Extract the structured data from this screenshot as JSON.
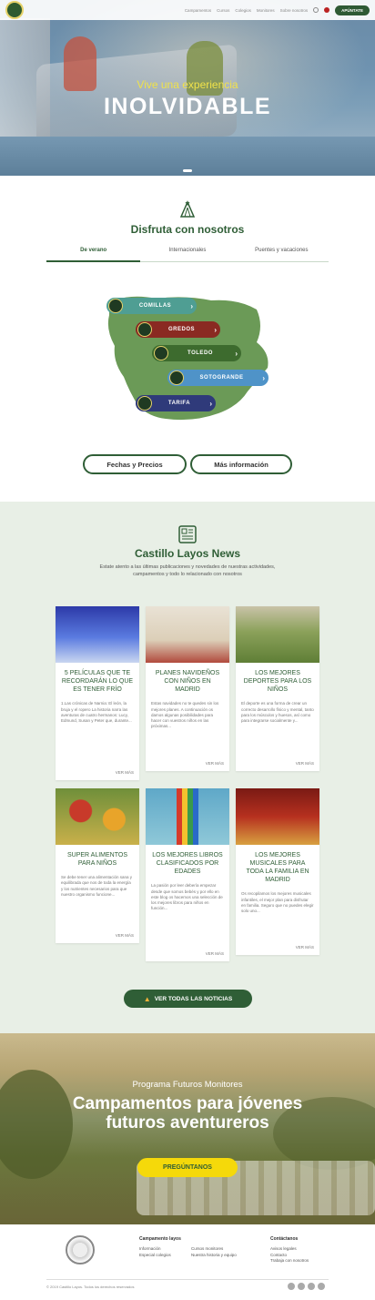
{
  "header": {
    "nav": [
      "Campamentos",
      "Cursos",
      "Colegios",
      "Monitores",
      "Sobre nosotros"
    ],
    "cta": "APÚNTATE"
  },
  "hero": {
    "subtitle": "Vive una experiencia",
    "title": "INOLVIDABLE"
  },
  "disfruta": {
    "title": "Disfruta con nosotros",
    "tabs": [
      "De verano",
      "Internacionales",
      "Puentes y vacaciones"
    ],
    "active_tab": "De verano",
    "locations": [
      "COMILLAS",
      "GREDOS",
      "TOLEDO",
      "SOTOGRANDE",
      "TARIFA"
    ],
    "location_colors": [
      "#4f9e93",
      "#8a2a22",
      "#3d6b2e",
      "#4f93c8",
      "#2f3a7a"
    ],
    "buttons": [
      "Fechas y Precios",
      "Más información"
    ]
  },
  "news": {
    "title": "Castillo Layos News",
    "description": "Estate atento a las últimas publicaciones y novedades de nuestras actividades, campamentos y todo lo relacionado con nosotros",
    "read_more": "VER MÁS",
    "cards": [
      {
        "title": "5 PELÍCULAS QUE TE RECORDARÁN LO QUE ES TENER FRÍO",
        "text": "1.Las crónicas de Narnia: El león, la bruja y el ropero La historia narra las aventuras de cuatro hermanos: Lucy, Edmund, Susan y Peter que, durante..."
      },
      {
        "title": "PLANES NAVIDEÑOS CON NIÑOS EN MADRID",
        "text": "Estas navidades no te quedes sin los mejores planes. A continuación os damos algunas posibilidades para hacer con vuestros niños en las próximas..."
      },
      {
        "title": "LOS MEJORES DEPORTES PARA LOS NIÑOS",
        "text": "El deporte es una forma de crear un correcto desarrollo físico y mental, tanto para los músculos y huesos, así como para integrarse socialmente y..."
      },
      {
        "title": "SUPER ALIMENTOS PARA NIÑOS",
        "text": "Se debe tener una alimentación sana y equilibrada que nos de toda la energía y los nutrientes necesarios para que nuestro organismo funcione..."
      },
      {
        "title": "LOS MEJORES LIBROS CLASIFICADOS POR EDADES",
        "text": "La pasión por leer debería empezar desde que somos bebés y por ello en este blog os hacemos una selección de los mejores libros para niños en función..."
      },
      {
        "title": "LOS MEJORES MUSICALES PARA TODA LA FAMILIA EN MADRID",
        "text": "Os recopilamos los mejores musicales infantiles, el mejor plan para disfrutar en familia. Seguro que no puedes elegir solo uno..."
      }
    ],
    "all_button": "VER TODAS LAS NOTICIAS"
  },
  "monitores": {
    "subtitle": "Programa Futuros Monitores",
    "title_line1": "Campamentos para jóvenes",
    "title_line2": "futuros aventureros",
    "button": "PREGÚNTANOS"
  },
  "footer": {
    "col1": {
      "heading": "Campamento layos",
      "items": [
        "Información",
        "Especial colegios"
      ]
    },
    "col2": {
      "heading": "",
      "items": [
        "Cursos monitores",
        "Nuestra historia y equipo"
      ]
    },
    "col3": {
      "heading": "Contáctanos",
      "items": [
        "Avisos legales",
        "Contacto",
        "Trabaja con nosotros"
      ]
    },
    "copyright": "© 2019 Castillo Layos. Todos los derechos reservados"
  }
}
